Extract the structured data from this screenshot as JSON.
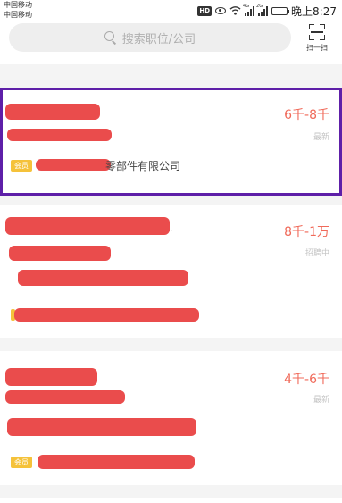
{
  "status_bar": {
    "carrier_1": "中国移动",
    "carrier_2": "中国移动",
    "hd_label": "HD",
    "sig1_tag": "4G",
    "sig2_tag": "2G",
    "time": "晚上8:27"
  },
  "search": {
    "placeholder": "搜索职位/公司",
    "scan_label": "扫一扫"
  },
  "jobs": [
    {
      "salary": "6千-8千",
      "status": "最新",
      "badge": "会员",
      "company_visible": "零部件有限公司"
    },
    {
      "salary": "8千-1万",
      "status": "招聘中"
    },
    {
      "salary": "4千-6千",
      "status": "最新",
      "badge": "会员"
    }
  ],
  "colors": {
    "salary": "#f06a5a",
    "redaction": "#ea4c4c",
    "vip_badge": "#f5c23a",
    "highlight_border": "#5e1fa8"
  }
}
